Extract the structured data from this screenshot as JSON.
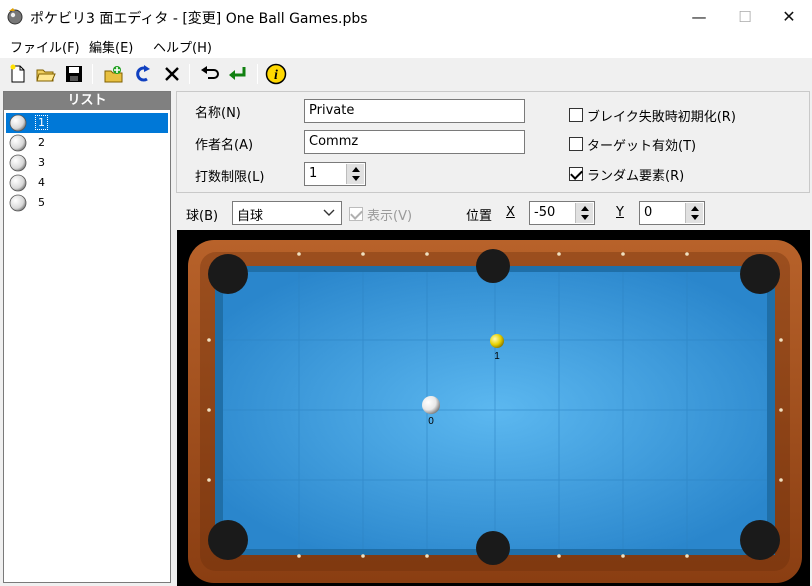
{
  "window": {
    "title": "ポケビリ3 面エディタ - [変更] One Ball Games.pbs",
    "minimize": "—",
    "maximize": "☐",
    "close": "✕"
  },
  "menu": [
    "ファイル(F)",
    "編集(E)",
    "ヘルプ(H)"
  ],
  "toolbar": {
    "icons": [
      "new-file-icon",
      "open-folder-icon",
      "save-icon",
      "add-stage-icon",
      "rotate-icon",
      "delete-icon",
      "undo-icon",
      "enter-icon",
      "info-icon"
    ],
    "info_glyph": "i"
  },
  "list": {
    "header": "リスト",
    "items": [
      "1",
      "2",
      "3",
      "4",
      "5"
    ],
    "selected_index": 0
  },
  "properties": {
    "name_label": "名称(N)",
    "name_value": "Private",
    "author_label": "作者名(A)",
    "author_value": "Commz",
    "shot_limit_label": "打数制限(L)",
    "shot_limit_value": "1",
    "break_reset_label": "ブレイク失敗時初期化(R)",
    "break_reset_checked": false,
    "target_enabled_label": "ターゲット有効(T)",
    "target_enabled_checked": false,
    "random_label": "ランダム要素(R)",
    "random_checked": true
  },
  "ball_controls": {
    "ball_label": "球(B)",
    "ball_value": "自球",
    "show_label": "表示(V)",
    "show_checked": true,
    "position_label": "位置",
    "x_label": "X",
    "x_value": "-50",
    "y_label": "Y",
    "y_value": "0"
  },
  "table": {
    "balls": [
      {
        "label": "1",
        "color": "#e6d000"
      },
      {
        "label": "0",
        "color": "#f2f2f2"
      }
    ],
    "felt_color": "#3aa0e6",
    "rail_color": "#a8501e"
  }
}
